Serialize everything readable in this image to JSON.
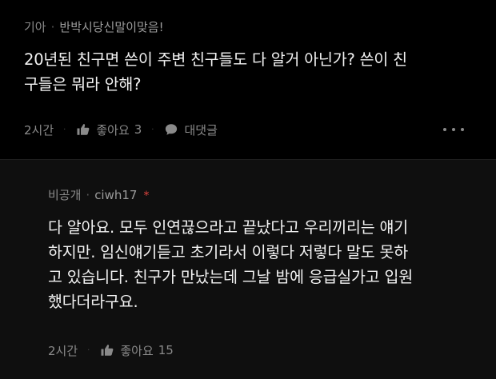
{
  "comments": [
    {
      "author": "기아",
      "separator": "·",
      "title": "반박시당신말이맞음!",
      "body_lines": [
        "20년된 친구면 쓴이 주변 친구들도 다 알거 아닌가? 쓴이 친",
        "구들은 뭐라 안해?"
      ],
      "time": "2시간",
      "dot": "·",
      "like_label": "좋아요",
      "like_count": "3",
      "reply_label": "대댓글",
      "icons": {
        "like": "thumbs-up-icon",
        "reply": "speech-bubble-icon",
        "more": "more-horizontal-icon"
      }
    },
    {
      "author": "비공개",
      "separator": "·",
      "name": "ciwh17",
      "star": "*",
      "body_lines": [
        "다 알아요. 모두 인연끊으라고 끝났다고 우리끼리는 얘기",
        "하지만. 임신얘기듣고 초기라서 이렇다 저렇다 말도 못하",
        "고 있습니다. 친구가 만났는데 그날 밤에 응급실가고 입원",
        "했다더라구요."
      ],
      "time": "2시간",
      "dot": "·",
      "like_label": "좋아요",
      "like_count": "15",
      "icons": {
        "like": "thumbs-up-icon"
      }
    }
  ],
  "colors": {
    "background": "#000000",
    "reply_background": "#0f0f0f",
    "text": "#f2f2f2",
    "meta": "#8a8a8a",
    "star": "#e0443e"
  }
}
